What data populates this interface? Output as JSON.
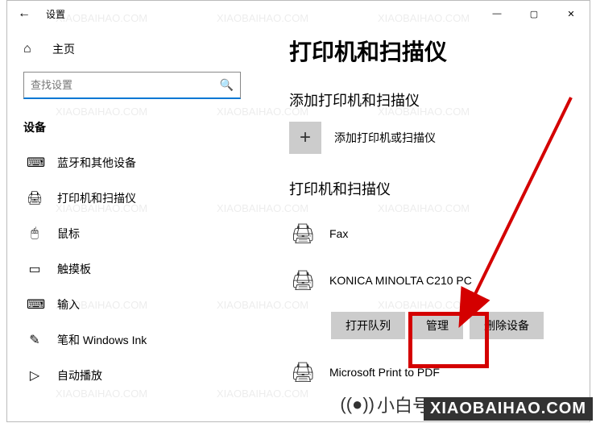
{
  "titlebar": {
    "back": "←",
    "title": "设置",
    "min": "—",
    "max": "▢",
    "close": "✕"
  },
  "home": {
    "label": "主页"
  },
  "search": {
    "placeholder": "查找设置"
  },
  "section": "设备",
  "nav": {
    "bt": "蓝牙和其他设备",
    "prn": "打印机和扫描仪",
    "mouse": "鼠标",
    "touch": "触摸板",
    "input": "输入",
    "pen": "笔和 Windows Ink",
    "auto": "自动播放"
  },
  "main": {
    "h1": "打印机和扫描仪",
    "addh": "添加打印机和扫描仪",
    "addt": "添加打印机或扫描仪",
    "listh": "打印机和扫描仪",
    "fax": "Fax",
    "km": "KONICA MINOLTA C210 PC",
    "mspdf": "Microsoft Print to PDF",
    "b1": "打开队列",
    "b2": "管理",
    "b3": "删除设备"
  },
  "wm": {
    "text": "XIAOBAIHAO.COM",
    "left": "小白号"
  }
}
